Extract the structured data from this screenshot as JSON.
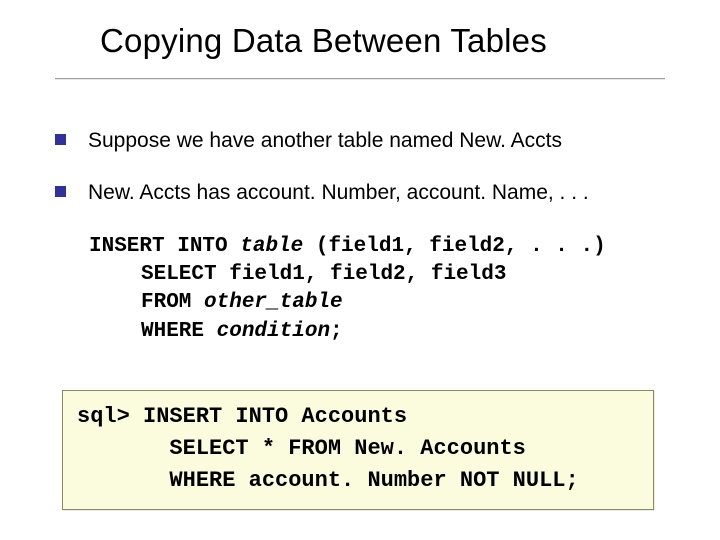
{
  "title": "Copying Data Between Tables",
  "bullets": [
    {
      "text": "Suppose we have another table named New. Accts"
    },
    {
      "text": "New. Accts has account. Number, account. Name, . . ."
    }
  ],
  "code": {
    "l1_a": "INSERT INTO ",
    "l1_b": "table",
    "l1_c": " (field1, field2, . . .)",
    "l2": "SELECT field1, field2, field3",
    "l3_a": "FROM ",
    "l3_b": "other_table",
    "l4_a": "WHERE ",
    "l4_b": "condition",
    "l4_c": ";"
  },
  "sqlbox": {
    "l1": "sql> INSERT INTO Accounts",
    "l2": "       SELECT * FROM New. Accounts",
    "l3": "       WHERE account. Number NOT NULL;"
  }
}
